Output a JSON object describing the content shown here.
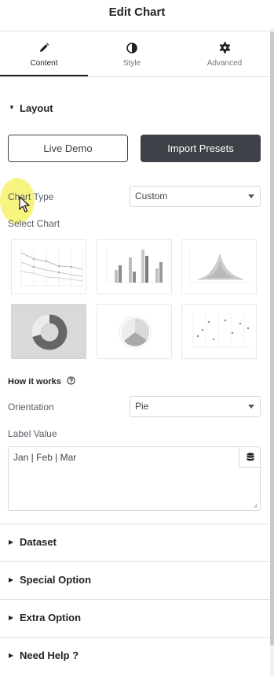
{
  "header": {
    "title": "Edit Chart"
  },
  "tabs": [
    {
      "label": "Content",
      "icon": "pencil-icon",
      "active": true
    },
    {
      "label": "Style",
      "icon": "contrast-icon",
      "active": false
    },
    {
      "label": "Advanced",
      "icon": "gear-icon",
      "active": false
    }
  ],
  "layout": {
    "heading": "Layout",
    "live_demo_label": "Live Demo",
    "import_presets_label": "Import Presets",
    "chart_type_label": "Chart Type",
    "chart_type_value": "Custom",
    "select_chart_label": "Select Chart",
    "charts": [
      "line-chart",
      "bar-chart",
      "radar-chart",
      "doughnut-chart",
      "pie-chart",
      "scatter-chart"
    ],
    "selected_chart": "doughnut-chart",
    "how_it_works_label": "How it works",
    "orientation_label": "Orientation",
    "orientation_value": "Pie",
    "label_value_label": "Label Value",
    "label_value_text": "Jan | Feb | Mar"
  },
  "sections": {
    "dataset": "Dataset",
    "special_option": "Special Option",
    "extra_option": "Extra Option",
    "need_help": "Need Help ?"
  },
  "colors": {
    "dark": "#3d4248",
    "text": "#1f2124",
    "border": "#d5d8dc",
    "selected_thumb": "#d8d9db"
  }
}
